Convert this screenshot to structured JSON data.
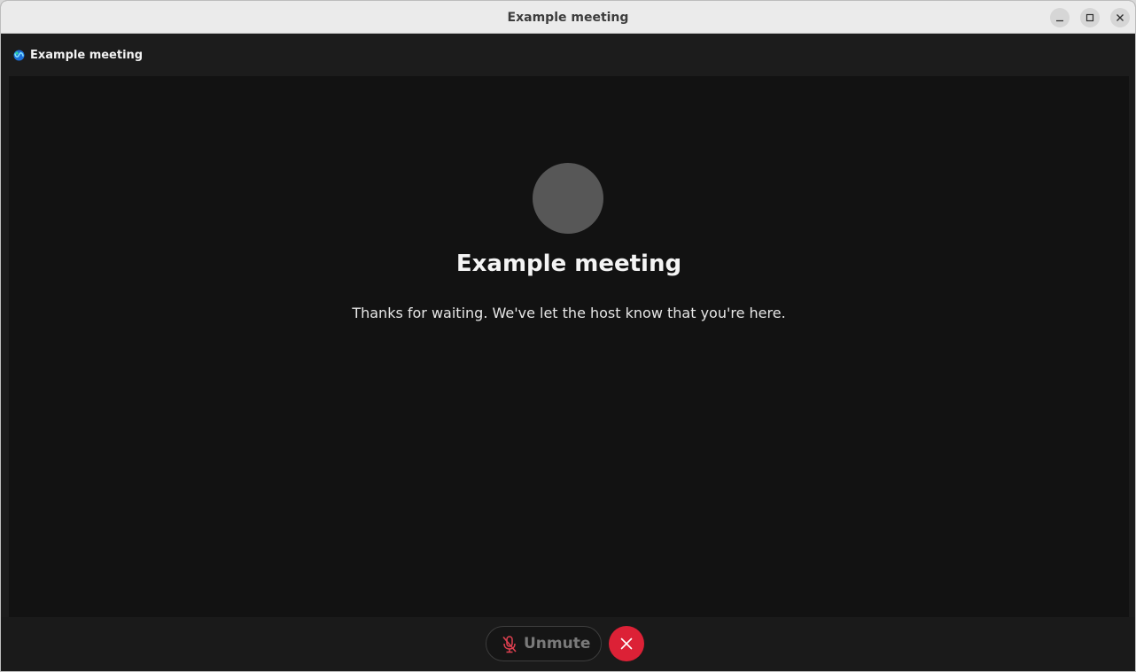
{
  "window": {
    "title": "Example meeting",
    "controls": {
      "minimize": "minimize-icon",
      "maximize": "maximize-icon",
      "close": "close-icon"
    }
  },
  "app_header": {
    "logo_icon": "webex-logo-icon",
    "title": "Example meeting"
  },
  "lobby": {
    "avatar_icon": "avatar-placeholder",
    "meeting_title": "Example meeting",
    "message": "Thanks for waiting. We've let the host know that you're here."
  },
  "controls": {
    "unmute_label": "Unmute",
    "unmute_icon": "microphone-muted-icon",
    "leave_icon": "close-icon"
  },
  "colors": {
    "leave_button": "#dc2136",
    "mic_muted_icon": "#e04050",
    "stage_background": "#121212"
  }
}
